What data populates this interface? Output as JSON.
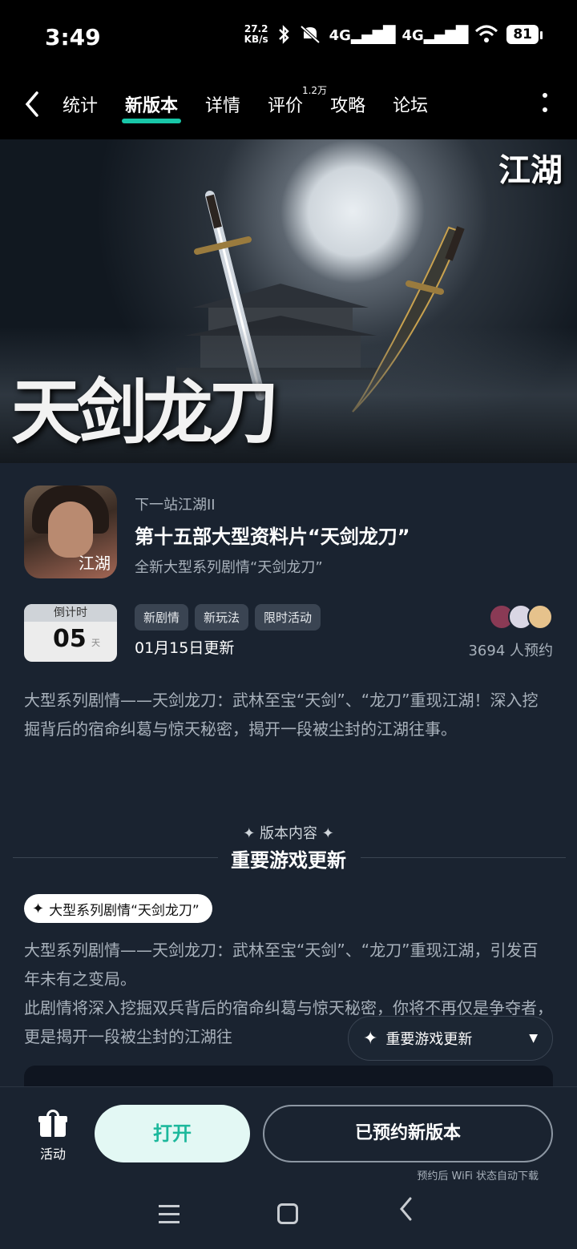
{
  "status": {
    "time": "3:49",
    "net_speed_value": "27.2",
    "net_speed_unit": "KB/s",
    "signal1": "4G",
    "signal2": "4G",
    "battery": "81"
  },
  "nav": {
    "tabs": [
      {
        "label": "统计"
      },
      {
        "label": "新版本",
        "active": true
      },
      {
        "label": "详情"
      },
      {
        "label": "评价",
        "badge": "1.2万"
      },
      {
        "label": "攻略"
      },
      {
        "label": "论坛"
      }
    ]
  },
  "banner": {
    "title": "天剑龙刀",
    "logo": "江湖"
  },
  "game": {
    "name": "下一站江湖II",
    "icon_logo": "江湖",
    "headline": "第十五部大型资料片“天剑龙刀”",
    "subline": "全新大型系列剧情“天剑龙刀”"
  },
  "countdown": {
    "label": "倒计时",
    "value": "05",
    "unit": "天"
  },
  "tags": [
    "新剧情",
    "新玩法",
    "限时活动"
  ],
  "update_date": "01月15日更新",
  "reserve_count": "3694 人预约",
  "description": "大型系列剧情——天剑龙刀：武林至宝“天剑”、“龙刀”重现江湖！深入挖掘背后的宿命纠葛与惊天秘密，揭开一段被尘封的江湖往事。",
  "section": {
    "kicker": "✦ 版本内容 ✦",
    "title": "重要游戏更新"
  },
  "feature": {
    "pill": "大型系列剧情“天剑龙刀”",
    "body_line1": "大型系列剧情——天剑龙刀：武林至宝“天剑”、“龙刀”重现江湖，引发百年未有之变局。",
    "body_line2": "此剧情将深入挖掘双兵背后的宿命纠葛与惊天秘密，你将不再仅是争夺者，更是揭开一段被尘封的江湖往"
  },
  "toc": {
    "label": "重要游戏更新"
  },
  "bottom": {
    "activity": "活动",
    "open": "打开",
    "reserved": "已预约新版本",
    "note": "预约后 WiFi 状态自动下载"
  },
  "colors": {
    "accent": "#18c7a8",
    "background": "#1a2330",
    "open_button_bg": "#e3f8f4",
    "open_button_text": "#1db89c"
  }
}
